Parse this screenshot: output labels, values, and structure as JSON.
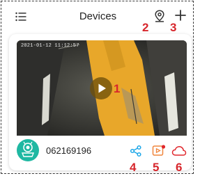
{
  "header": {
    "title": "Devices",
    "icons": [
      "menu-icon",
      "location-pin-icon",
      "plus-icon"
    ]
  },
  "device": {
    "timestamp": "2021-01-12 11:12:57",
    "id": "062169196",
    "actions": [
      "share-icon",
      "playback-icon",
      "cloud-icon"
    ]
  },
  "callouts": {
    "play": "1",
    "location": "2",
    "add": "3",
    "share": "4",
    "playback": "5",
    "cloud": "6"
  },
  "colors": {
    "accent": "#1aa6e8",
    "avatar": "#1fb8a2",
    "playback": "#f0853c",
    "notification_dot": "#e0262c",
    "cloud": "#e0262c",
    "callout": "#d7262c"
  }
}
